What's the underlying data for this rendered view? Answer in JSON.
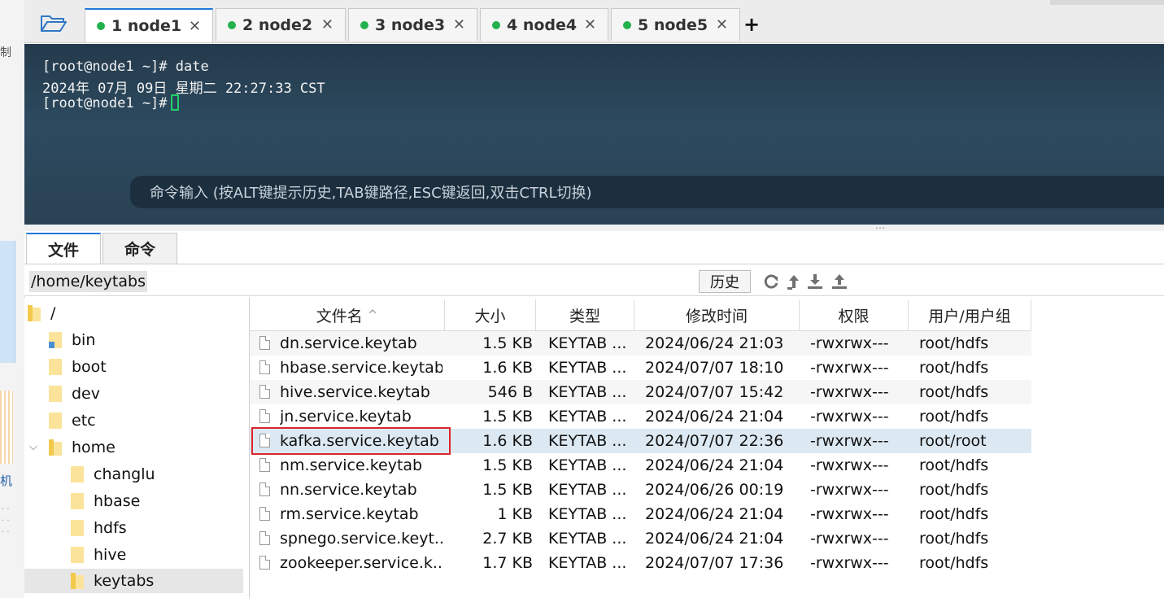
{
  "left_strip": {
    "char_top": "制",
    "char_bottom": "机"
  },
  "tabs": [
    {
      "label": "1 node1",
      "active": true
    },
    {
      "label": "2 node2",
      "active": false
    },
    {
      "label": "3 node3",
      "active": false
    },
    {
      "label": "4 node4",
      "active": false
    },
    {
      "label": "5 node5",
      "active": false
    }
  ],
  "tab_close_glyph": "✕",
  "add_tab_glyph": "+",
  "terminal": {
    "lines": [
      "[root@node1 ~]# date",
      "2024年 07月 09日 星期二 22:27:33 CST",
      "[root@node1 ~]#"
    ],
    "command_hint": "命令输入 (按ALT键提示历史,TAB键路径,ESC键返回,双击CTRL切换)"
  },
  "bottom_tabs": {
    "files": "文件",
    "commands": "命令"
  },
  "pathbar": {
    "path": "/home/keytabs",
    "history_label": "历史"
  },
  "tree": {
    "root": "/",
    "items": [
      "bin",
      "boot",
      "dev",
      "etc",
      "home",
      "changlu",
      "hbase",
      "hdfs",
      "hive",
      "keytabs"
    ]
  },
  "file_table": {
    "headers": {
      "name": "文件名",
      "sort_glyph": "^",
      "size": "大小",
      "type": "类型",
      "mtime": "修改时间",
      "perm": "权限",
      "owner": "用户/用户组"
    },
    "rows": [
      {
        "name": "dn.service.keytab",
        "size": "1.5 KB",
        "type": "KEYTAB ...",
        "mtime": "2024/06/24 21:03",
        "perm": "-rwxrwx---",
        "owner": "root/hdfs"
      },
      {
        "name": "hbase.service.keytab",
        "size": "1.6 KB",
        "type": "KEYTAB ...",
        "mtime": "2024/07/07 18:10",
        "perm": "-rwxrwx---",
        "owner": "root/hdfs"
      },
      {
        "name": "hive.service.keytab",
        "size": "546 B",
        "type": "KEYTAB ...",
        "mtime": "2024/07/07 15:42",
        "perm": "-rwxrwx---",
        "owner": "root/hdfs"
      },
      {
        "name": "jn.service.keytab",
        "size": "1.5 KB",
        "type": "KEYTAB ...",
        "mtime": "2024/06/24 21:04",
        "perm": "-rwxrwx---",
        "owner": "root/hdfs"
      },
      {
        "name": "kafka.service.keytab",
        "size": "1.6 KB",
        "type": "KEYTAB ...",
        "mtime": "2024/07/07 22:36",
        "perm": "-rwxrwx---",
        "owner": "root/root"
      },
      {
        "name": "nm.service.keytab",
        "size": "1.5 KB",
        "type": "KEYTAB ...",
        "mtime": "2024/06/24 21:04",
        "perm": "-rwxrwx---",
        "owner": "root/hdfs"
      },
      {
        "name": "nn.service.keytab",
        "size": "1.5 KB",
        "type": "KEYTAB ...",
        "mtime": "2024/06/26 00:19",
        "perm": "-rwxrwx---",
        "owner": "root/hdfs"
      },
      {
        "name": "rm.service.keytab",
        "size": "1 KB",
        "type": "KEYTAB ...",
        "mtime": "2024/06/24 21:04",
        "perm": "-rwxrwx---",
        "owner": "root/hdfs"
      },
      {
        "name": "spnego.service.keyt...",
        "size": "2.7 KB",
        "type": "KEYTAB ...",
        "mtime": "2024/06/24 21:04",
        "perm": "-rwxrwx---",
        "owner": "root/hdfs"
      },
      {
        "name": "zookeeper.service.k...",
        "size": "1.7 KB",
        "type": "KEYTAB ...",
        "mtime": "2024/07/07 17:36",
        "perm": "-rwxrwx---",
        "owner": "root/hdfs"
      }
    ]
  },
  "colors": {
    "active_tab_accent": "#1f7bd8",
    "status_dot": "#22b14c",
    "terminal_bg": "#2a4254",
    "highlight": "#d9262b",
    "folder": "#f7d774"
  }
}
